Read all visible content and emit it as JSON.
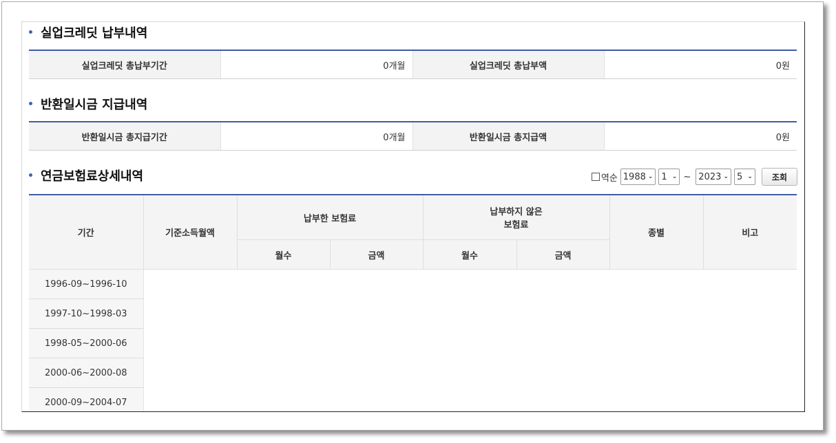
{
  "sections": {
    "unemployment": {
      "title": "실업크레딧 납부내역",
      "period_label": "실업크레딧 총납부기간",
      "period_value": "0개월",
      "amount_label": "실업크레딧 총납부액",
      "amount_value": "0원"
    },
    "lumpsum": {
      "title": "반환일시금 지급내역",
      "period_label": "반환일시금 총지급기간",
      "period_value": "0개월",
      "amount_label": "반환일시금 총지급액",
      "amount_value": "0원"
    },
    "detail": {
      "title": "연금보험료상세내역"
    }
  },
  "controls": {
    "reverse_label": "역순",
    "reverse_checked": false,
    "from_year": "1988",
    "from_month": "1",
    "separator": "~",
    "to_year": "2023",
    "to_month": "5",
    "search_label": "조회"
  },
  "table": {
    "headers": {
      "period": "기간",
      "base_income": "기준소득월액",
      "paid_group": "납부한 보험료",
      "unpaid_group_line1": "납부하지 않은",
      "unpaid_group_line2": "보험료",
      "months": "월수",
      "amount": "금액",
      "type": "종별",
      "note": "비고"
    },
    "rows": [
      {
        "period": "1996-09~1996-10"
      },
      {
        "period": "1997-10~1998-03"
      },
      {
        "period": "1998-05~2000-06"
      },
      {
        "period": "2000-06~2000-08"
      },
      {
        "period": "2000-09~2004-07"
      }
    ]
  }
}
